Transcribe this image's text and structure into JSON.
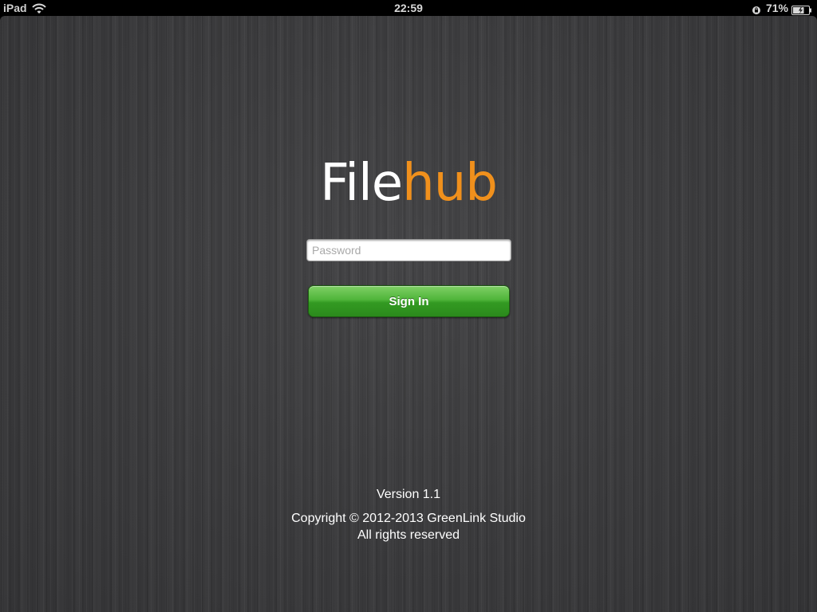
{
  "status_bar": {
    "carrier": "iPad",
    "time": "22:59",
    "battery_percent": "71%",
    "icons": [
      "wifi-icon",
      "orientation-lock-icon",
      "battery-icon"
    ],
    "battery_level": 0.71
  },
  "logo": {
    "part_1": "File",
    "part_2": "hub",
    "colors": {
      "part_1": "#ffffff",
      "part_2": "#f0901c"
    }
  },
  "login_form": {
    "password_placeholder": "Password",
    "password_value": "",
    "sign_in_label": "Sign In",
    "button_color": "#3aa52a"
  },
  "footer": {
    "version": "Version 1.1",
    "copyright": "Copyright © 2012-2013 GreenLink Studio",
    "rights": "All rights reserved"
  }
}
